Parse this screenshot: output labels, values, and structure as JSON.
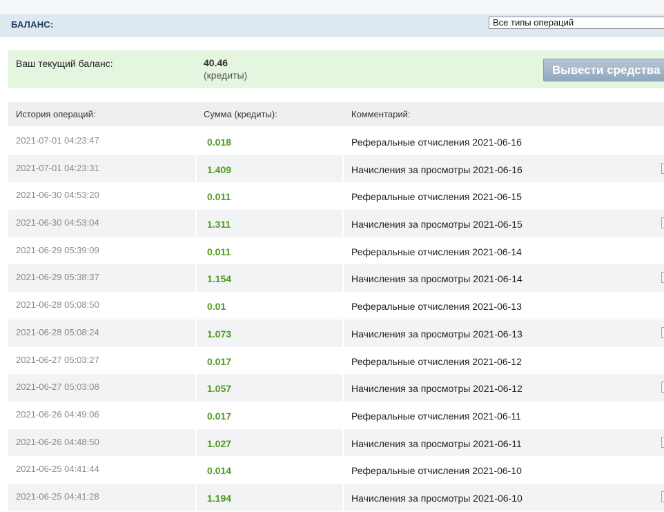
{
  "header": {
    "title": "БАЛАНС:",
    "filter_selected": "Все типы операций"
  },
  "balance": {
    "label": "Ваш текущий баланс:",
    "value": "40.46",
    "unit": "(кредиты)",
    "withdraw_label": "Вывести средства"
  },
  "table": {
    "headers": {
      "date": "История операций:",
      "amount": "Сумма (кредиты):",
      "comment": "Комментарий:"
    },
    "rows": [
      {
        "date": "2021-07-01 04:23:47",
        "amount": "0.018",
        "comment": "Реферальные отчисления 2021-06-16"
      },
      {
        "date": "2021-07-01 04:23:31",
        "amount": "1.409",
        "comment": "Начисления за просмотры 2021-06-16"
      },
      {
        "date": "2021-06-30 04:53:20",
        "amount": "0.011",
        "comment": "Реферальные отчисления 2021-06-15"
      },
      {
        "date": "2021-06-30 04:53:04",
        "amount": "1.311",
        "comment": "Начисления за просмотры 2021-06-15"
      },
      {
        "date": "2021-06-29 05:39:09",
        "amount": "0.011",
        "comment": "Реферальные отчисления 2021-06-14"
      },
      {
        "date": "2021-06-29 05:38:37",
        "amount": "1.154",
        "comment": "Начисления за просмотры 2021-06-14"
      },
      {
        "date": "2021-06-28 05:08:50",
        "amount": "0.01",
        "comment": "Реферальные отчисления 2021-06-13"
      },
      {
        "date": "2021-06-28 05:08:24",
        "amount": "1.073",
        "comment": "Начисления за просмотры 2021-06-13"
      },
      {
        "date": "2021-06-27 05:03:27",
        "amount": "0.017",
        "comment": "Реферальные отчисления 2021-06-12"
      },
      {
        "date": "2021-06-27 05:03:08",
        "amount": "1.057",
        "comment": "Начисления за просмотры 2021-06-12"
      },
      {
        "date": "2021-06-26 04:49:06",
        "amount": "0.017",
        "comment": "Реферальные отчисления 2021-06-11"
      },
      {
        "date": "2021-06-26 04:48:50",
        "amount": "1.027",
        "comment": "Начисления за просмотры 2021-06-11"
      },
      {
        "date": "2021-06-25 04:41:44",
        "amount": "0.014",
        "comment": "Реферальные отчисления 2021-06-10"
      },
      {
        "date": "2021-06-25 04:41:28",
        "amount": "1.194",
        "comment": "Начисления за просмотры 2021-06-10"
      }
    ]
  },
  "colors": {
    "amount_green": "#4c9a1f",
    "header_bg": "#dde8f1",
    "balance_bg": "#e4f5e0",
    "button_bg": "#9fb3c6"
  }
}
